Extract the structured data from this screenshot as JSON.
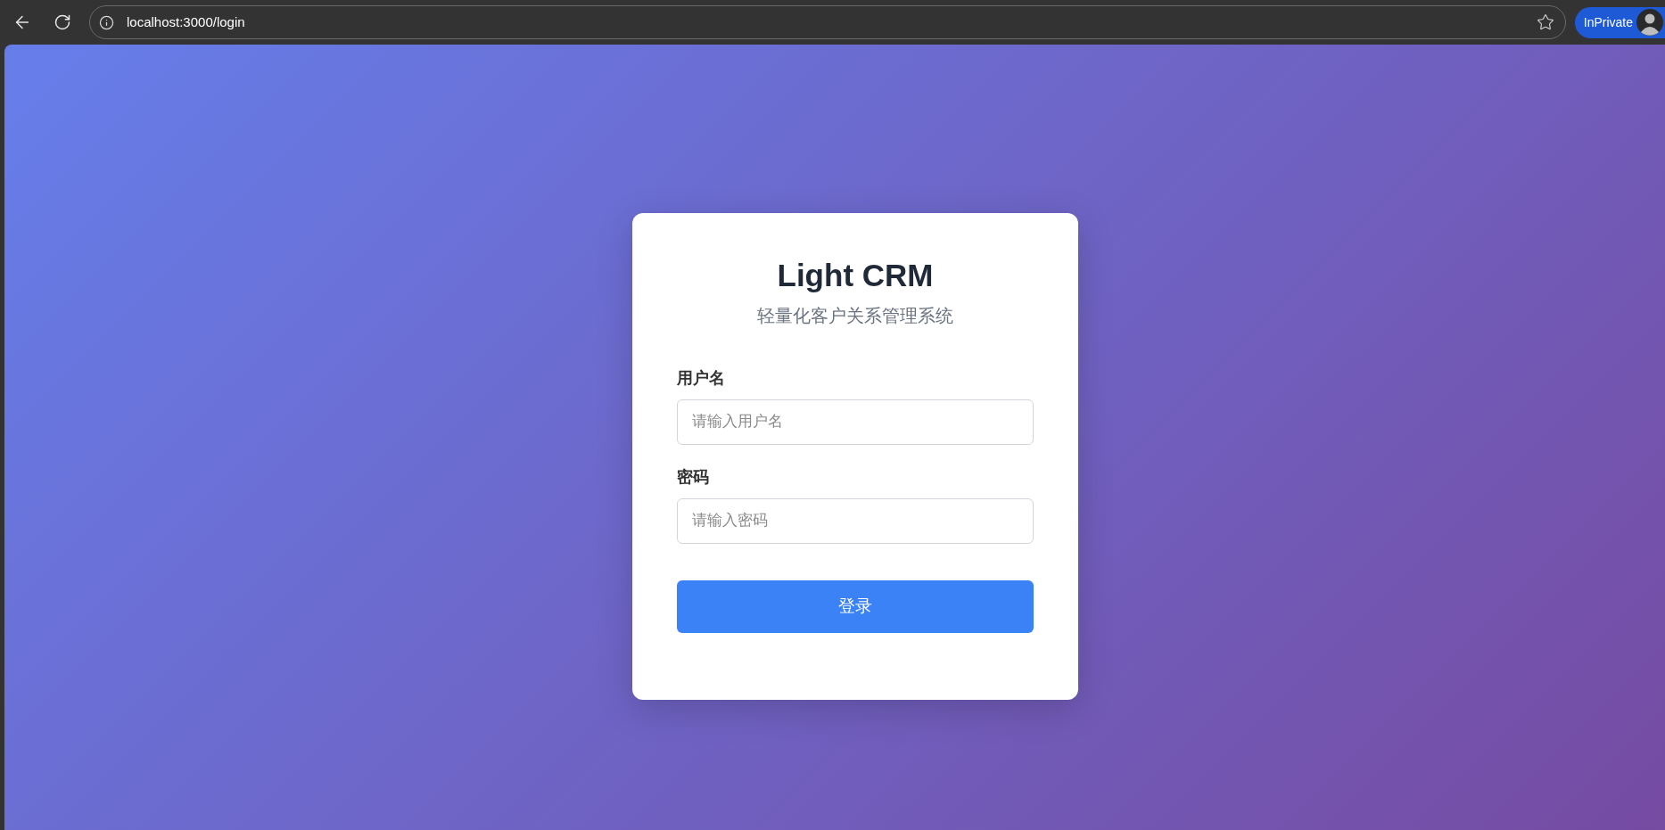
{
  "browser": {
    "url": "localhost:3000/login",
    "profile_badge": "InPrivate"
  },
  "login_card": {
    "title": "Light CRM",
    "subtitle": "轻量化客户关系管理系统",
    "fields": [
      {
        "label": "用户名",
        "placeholder": "请输入用户名"
      },
      {
        "label": "密码",
        "placeholder": "请输入密码"
      }
    ],
    "submit_button": "登录"
  }
}
